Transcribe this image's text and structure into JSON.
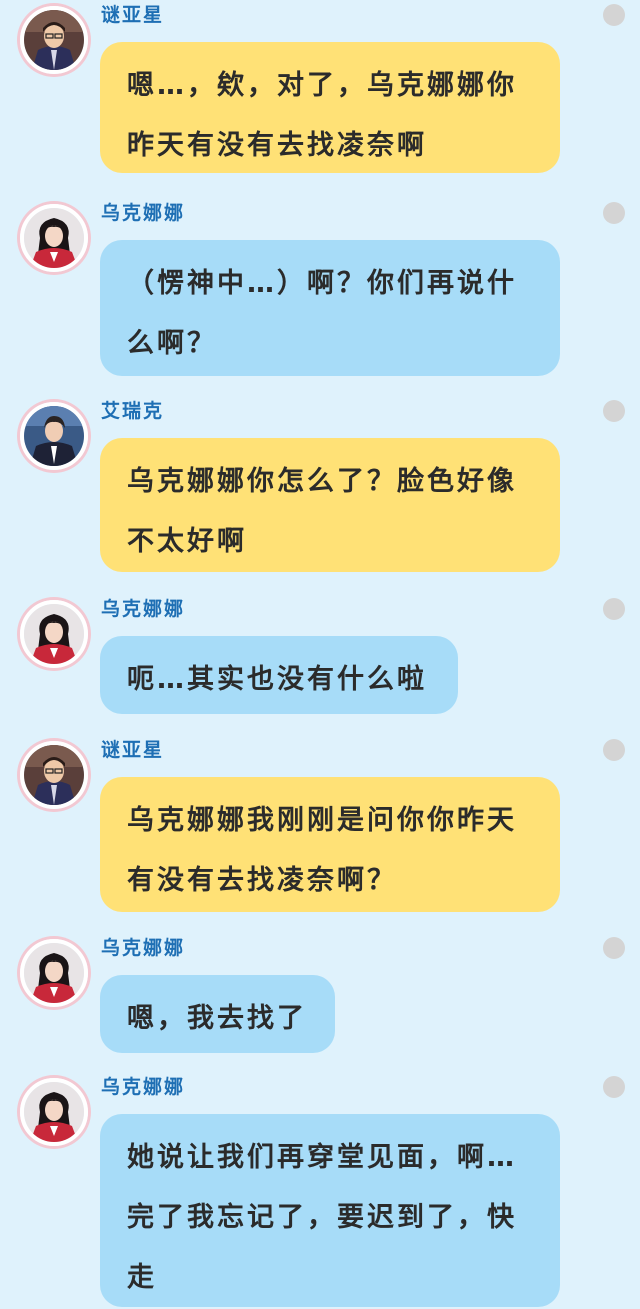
{
  "colors": {
    "background": "#dff2fc",
    "name_text": "#1e6fb4",
    "bubble_yellow": "#ffe176",
    "bubble_blue": "#a7dcf8",
    "status_dot": "#d4d4d4"
  },
  "messages": [
    {
      "sender": "谜亚星",
      "text": "嗯…，欸，对了，乌克娜娜你昨天有没有去找凌奈啊",
      "avatar_icon": "boy-glasses-avatar-icon",
      "bubble": "yellow"
    },
    {
      "sender": "乌克娜娜",
      "text": "（愣神中…）啊？你们再说什么啊？",
      "avatar_icon": "girl-red-uniform-avatar-icon",
      "bubble": "blue"
    },
    {
      "sender": "艾瑞克",
      "text": "乌克娜娜你怎么了？脸色好像不太好啊",
      "avatar_icon": "boy-dark-uniform-avatar-icon",
      "bubble": "yellow"
    },
    {
      "sender": "乌克娜娜",
      "text": "呃…其实也没有什么啦",
      "avatar_icon": "girl-red-uniform-avatar-icon",
      "bubble": "blue"
    },
    {
      "sender": "谜亚星",
      "text": "乌克娜娜我刚刚是问你你昨天有没有去找凌奈啊？",
      "avatar_icon": "boy-glasses-avatar-icon",
      "bubble": "yellow"
    },
    {
      "sender": "乌克娜娜",
      "text": "嗯，我去找了",
      "avatar_icon": "girl-red-uniform-avatar-icon",
      "bubble": "blue"
    },
    {
      "sender": "乌克娜娜",
      "text": "她说让我们再穿堂见面，啊…完了我忘记了，要迟到了，快走",
      "avatar_icon": "girl-red-uniform-avatar-icon",
      "bubble": "blue"
    }
  ]
}
